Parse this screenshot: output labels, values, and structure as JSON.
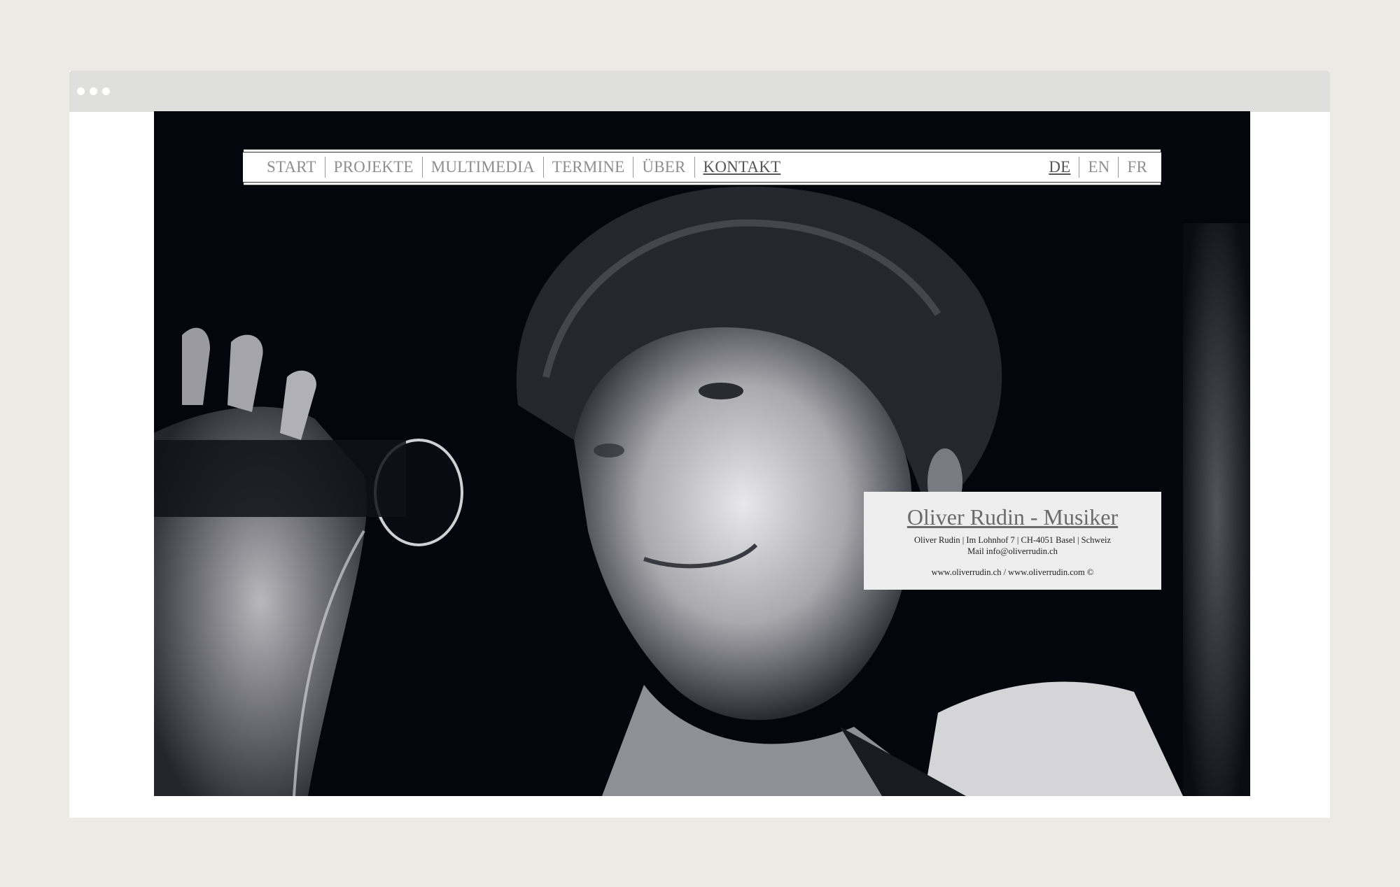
{
  "nav": {
    "items": [
      {
        "label": "START"
      },
      {
        "label": "PROJEKTE"
      },
      {
        "label": "MULTIMEDIA"
      },
      {
        "label": "TERMINE"
      },
      {
        "label": "ÜBER"
      },
      {
        "label": "KONTAKT",
        "active": true
      }
    ],
    "languages": [
      {
        "label": "DE",
        "active": true
      },
      {
        "label": "EN"
      },
      {
        "label": "FR"
      }
    ]
  },
  "contact": {
    "title": "Oliver Rudin - Musiker",
    "address": "Oliver Rudin | Im Lohnhof 7 | CH-4051 Basel | Schweiz",
    "mail": "Mail info@oliverrudin.ch",
    "web": "www.oliverrudin.ch / www.oliverrudin.com ©"
  },
  "hero": {
    "image": "black-and-white photo of musician singing into microphone"
  }
}
